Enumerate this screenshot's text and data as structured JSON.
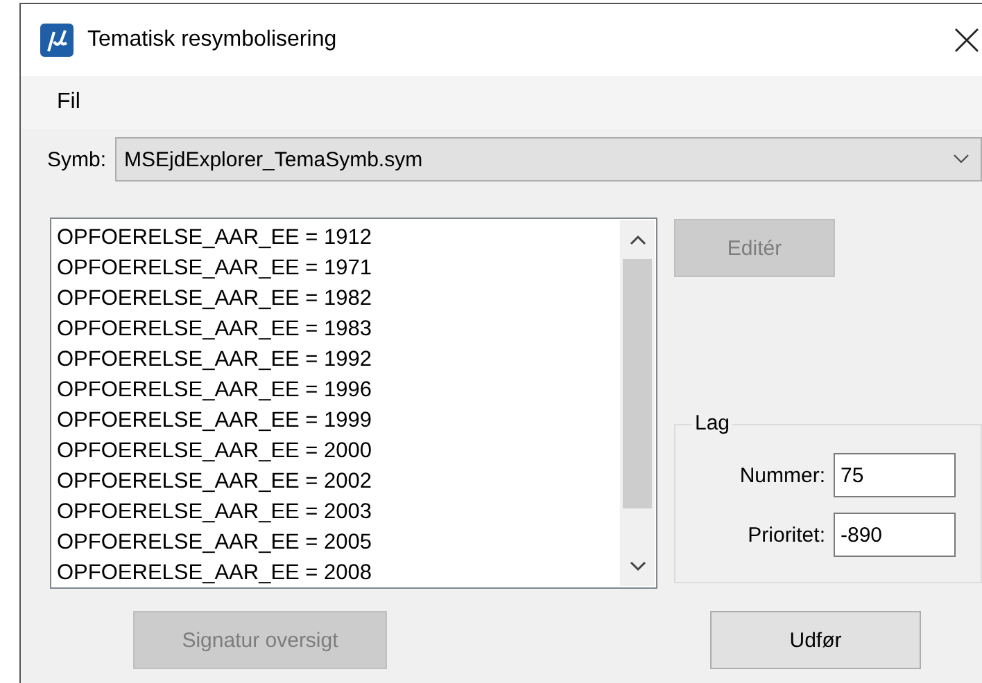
{
  "window": {
    "title": "Tematisk resymbolisering"
  },
  "menu": [
    {
      "label": "Fil"
    }
  ],
  "symb": {
    "label": "Symb:",
    "value": "MSEjdExplorer_TemaSymb.sym"
  },
  "list": {
    "items": [
      {
        "label": "OPFOERELSE_AAR_EE = 1912",
        "selected": false
      },
      {
        "label": "OPFOERELSE_AAR_EE = 1971",
        "selected": false
      },
      {
        "label": "OPFOERELSE_AAR_EE = 1982",
        "selected": false
      },
      {
        "label": "OPFOERELSE_AAR_EE = 1983",
        "selected": false
      },
      {
        "label": "OPFOERELSE_AAR_EE = 1992",
        "selected": false
      },
      {
        "label": "OPFOERELSE_AAR_EE = 1996",
        "selected": false
      },
      {
        "label": "OPFOERELSE_AAR_EE = 1999",
        "selected": false
      },
      {
        "label": "OPFOERELSE_AAR_EE = 2000",
        "selected": false
      },
      {
        "label": "OPFOERELSE_AAR_EE = 2002",
        "selected": false
      },
      {
        "label": "OPFOERELSE_AAR_EE = 2003",
        "selected": false
      },
      {
        "label": "OPFOERELSE_AAR_EE = 2005",
        "selected": false
      },
      {
        "label": "OPFOERELSE_AAR_EE = 2008",
        "selected": false
      }
    ]
  },
  "edit_button": {
    "label": "Editér",
    "disabled": true
  },
  "lag": {
    "title": "Lag",
    "fields": [
      {
        "label": "Nummer:",
        "value": "75"
      },
      {
        "label": "Prioritet:",
        "value": "-890"
      }
    ]
  },
  "bottom_buttons": [
    {
      "label": "Signatur oversigt",
      "disabled": true
    },
    {
      "label": "Udfør",
      "disabled": false
    }
  ]
}
